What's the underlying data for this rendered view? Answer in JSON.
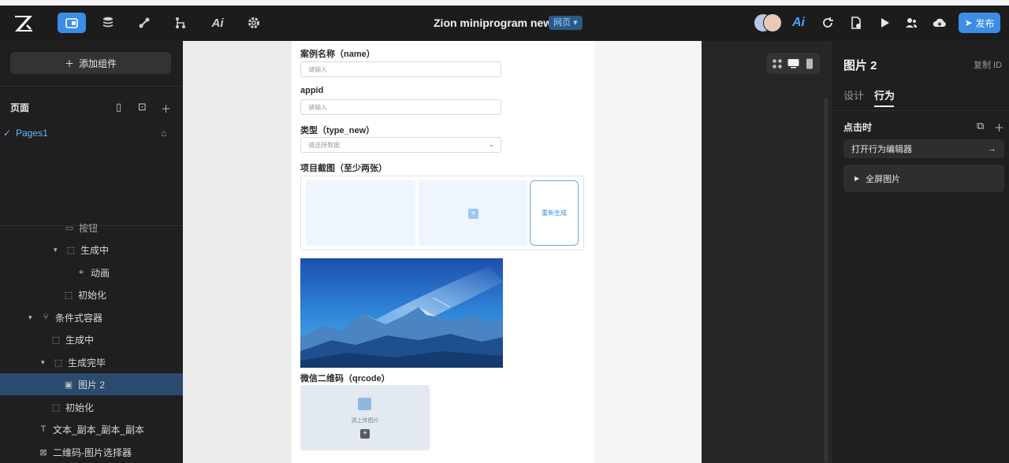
{
  "topbar": {
    "project_title": "Zion miniprogram new",
    "mode": "网页",
    "publish_label": "发布",
    "tools_left": [
      "component-icon",
      "database-icon",
      "api-icon",
      "flow-icon",
      "ai-icon",
      "settings-icon"
    ],
    "tools_right": [
      "ai-icon",
      "refresh-icon",
      "file-icon",
      "play-icon",
      "users-icon",
      "cloud-icon"
    ],
    "accent": "#3a8ee6"
  },
  "left": {
    "add_component": "添加组件",
    "pages_label": "页面",
    "page_name": "Pages1",
    "tree": [
      {
        "label": "按钮",
        "icon": "button-icon"
      },
      {
        "label": "生成中",
        "icon": "container-icon"
      },
      {
        "label": "动画",
        "icon": "animation-icon"
      },
      {
        "label": "初始化",
        "icon": "container-icon"
      },
      {
        "label": "条件式容器",
        "icon": "conditional-icon"
      },
      {
        "label": "生成中",
        "icon": "container-icon"
      },
      {
        "label": "生成完毕",
        "icon": "container-icon"
      },
      {
        "label": "图片 2",
        "icon": "image-icon"
      },
      {
        "label": "初始化",
        "icon": "container-icon"
      },
      {
        "label": "文本_副本_副本_副本",
        "icon": "text-icon"
      },
      {
        "label": "二维码-图片选择器",
        "icon": "image-picker-icon"
      }
    ]
  },
  "canvas": {
    "f1_label": "案例名称（name）",
    "f1_placeholder": "请输入",
    "f2_label": "appid",
    "f2_placeholder": "请输入",
    "f3_label": "类型（type_new）",
    "f3_placeholder": "请选择数据",
    "f4_label": "项目截图（至少两张）",
    "regen_label": "重新生成",
    "qr_label": "微信二维码（qrcode）",
    "upload_text": "请上传图片"
  },
  "right": {
    "title": "图片 2",
    "copy_id": "复制 ID",
    "tab_design": "设计",
    "tab_behavior": "行为",
    "on_click": "点击时",
    "open_editor": "打开行为编辑器",
    "action": "全屏图片"
  }
}
